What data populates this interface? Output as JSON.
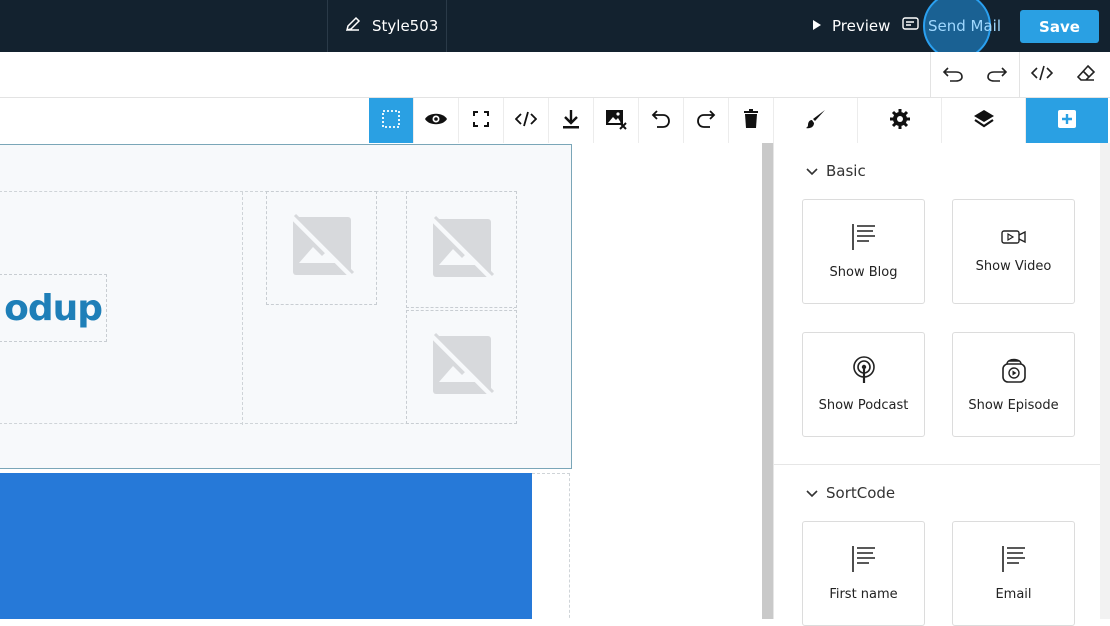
{
  "topbar": {
    "template_name": "Style503",
    "preview_label": "Preview",
    "send_mail_label": "Send Mail",
    "save_label": "Save"
  },
  "subbar": {
    "tools": [
      "undo-icon",
      "redo-icon",
      "code-icon",
      "eraser-icon"
    ]
  },
  "toolbar": {
    "tools": [
      "select-component-icon",
      "preview-eye-icon",
      "fullscreen-icon",
      "code-icon",
      "download-icon",
      "remove-image-icon",
      "undo-icon",
      "redo-icon",
      "trash-icon"
    ],
    "active_tool": "select-component-icon"
  },
  "panel_tabs": {
    "tabs": [
      "brush-icon",
      "settings-icon",
      "layers-icon",
      "add-blocks-icon"
    ],
    "active_tab": "add-blocks-icon"
  },
  "canvas": {
    "logo_text": "odup",
    "section2_color": "#2679d8"
  },
  "blocks_panel": {
    "categories": [
      {
        "name": "Basic",
        "blocks": [
          {
            "label": "Show Blog",
            "icon": "blog-lines-icon"
          },
          {
            "label": "Show Video",
            "icon": "video-icon"
          },
          {
            "label": "Show Podcast",
            "icon": "podcast-icon"
          },
          {
            "label": "Show Episode",
            "icon": "episode-icon"
          }
        ]
      },
      {
        "name": "SortCode",
        "blocks": [
          {
            "label": "First name",
            "icon": "text-lines-icon"
          },
          {
            "label": "Email",
            "icon": "text-lines-icon"
          }
        ]
      }
    ]
  },
  "colors": {
    "topbar_bg": "#13222f",
    "accent": "#2aa0e3",
    "logo": "#1e7fb8"
  }
}
